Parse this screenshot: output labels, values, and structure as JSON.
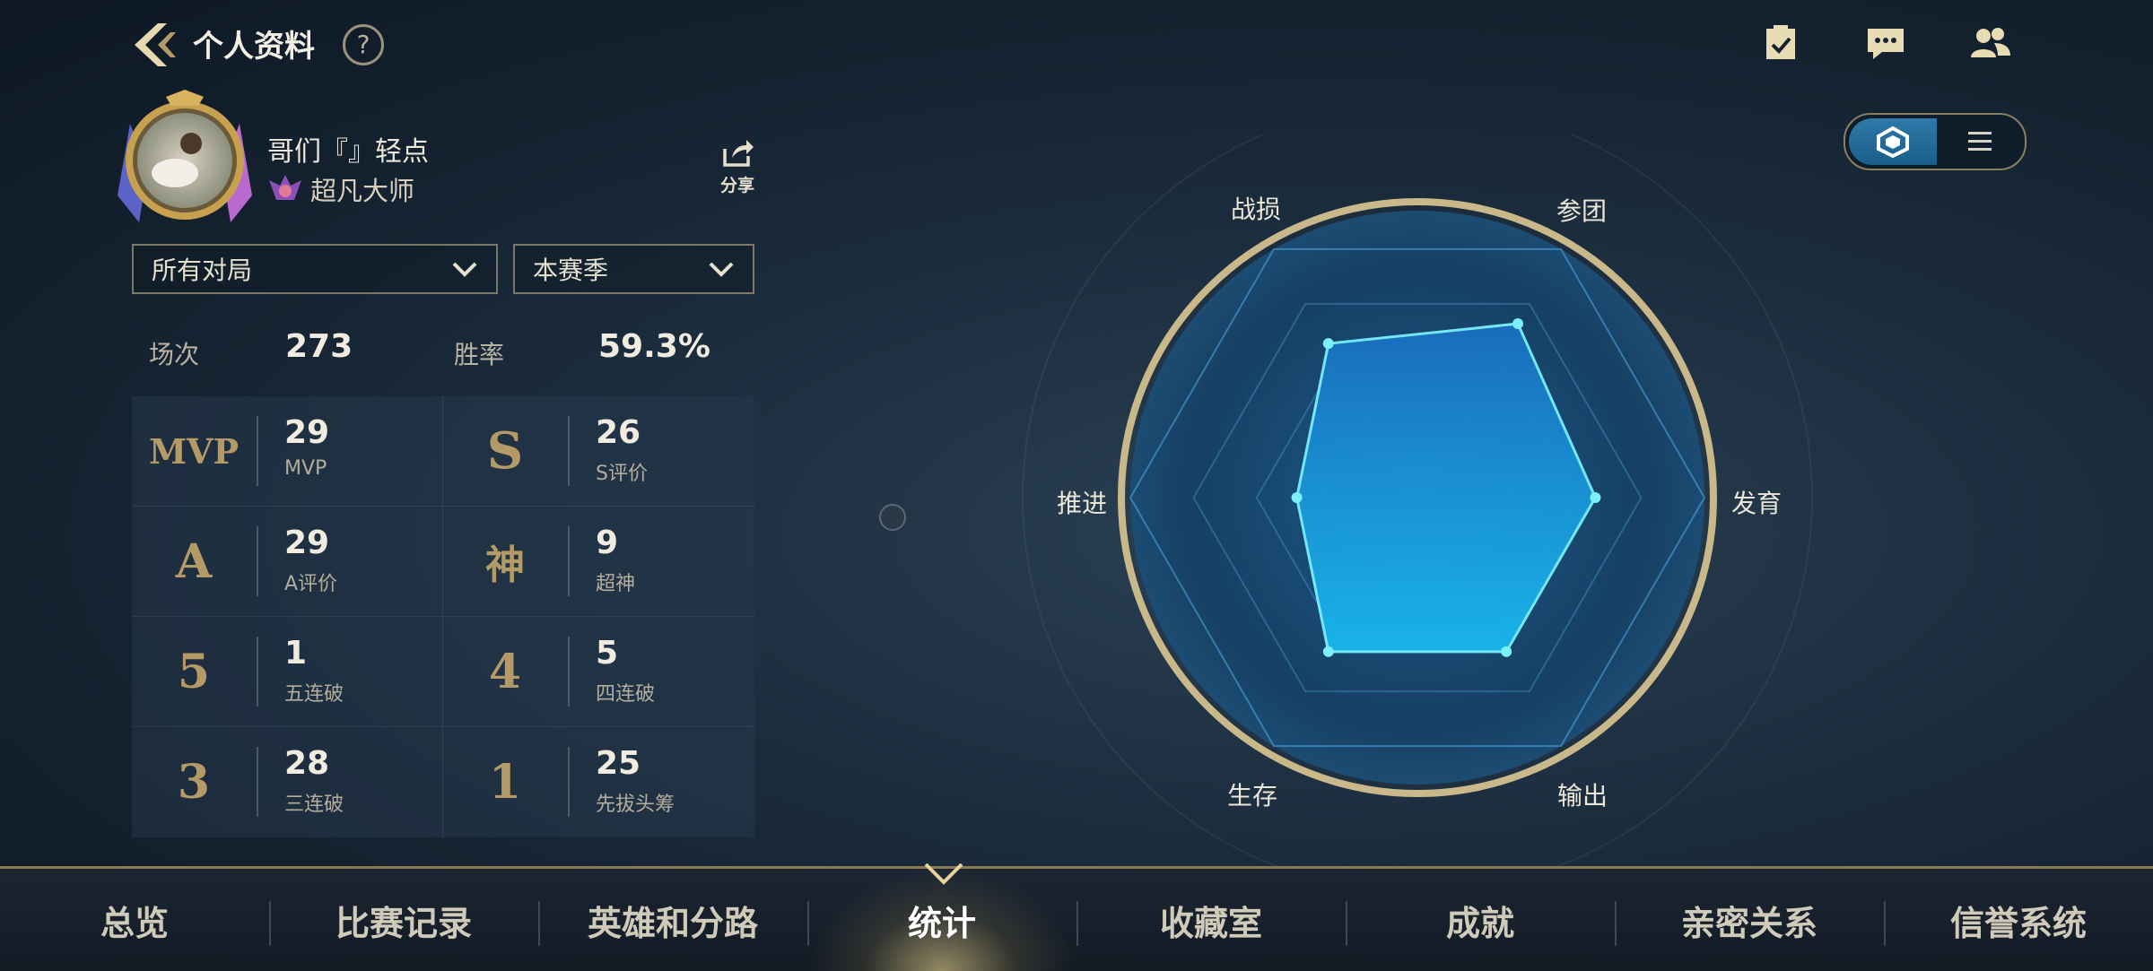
{
  "header": {
    "title": "个人资料",
    "help_symbol": "?",
    "icons": [
      "task-check-icon",
      "chat-icon",
      "friends-icon"
    ]
  },
  "profile": {
    "name": "哥们『』轻点",
    "rank": "超凡大师",
    "share_label": "分享"
  },
  "filters": {
    "mode": "所有对局",
    "season": "本赛季"
  },
  "summary": {
    "games_label": "场次",
    "games_value": "273",
    "winrate_label": "胜率",
    "winrate_value": "59.3%"
  },
  "stats": [
    {
      "icon_text": "MVP",
      "value": "29",
      "label": "MVP"
    },
    {
      "icon_text": "S",
      "value": "26",
      "label": "S评价"
    },
    {
      "icon_text": "A",
      "value": "29",
      "label": "A评价"
    },
    {
      "icon_text": "神",
      "value": "9",
      "label": "超神"
    },
    {
      "icon_text": "5",
      "value": "1",
      "label": "五连破"
    },
    {
      "icon_text": "4",
      "value": "5",
      "label": "四连破"
    },
    {
      "icon_text": "3",
      "value": "28",
      "label": "三连破"
    },
    {
      "icon_text": "1",
      "value": "25",
      "label": "先拔头筹"
    }
  ],
  "radar": {
    "axes": [
      "战损",
      "参团",
      "发育",
      "输出",
      "生存",
      "推进"
    ],
    "values": [
      0.62,
      0.7,
      0.62,
      0.62,
      0.62,
      0.42
    ]
  },
  "view_toggle": {
    "active": "radar",
    "icons": [
      "hexagon-icon",
      "list-icon"
    ]
  },
  "nav": {
    "tabs": [
      "总览",
      "比赛记录",
      "英雄和分路",
      "统计",
      "收藏室",
      "成就",
      "亲密关系",
      "信誉系统"
    ],
    "active_index": 3
  },
  "colors": {
    "accent_gold": "#b49a66",
    "radar_fill": "#1aa6e6",
    "radar_dot": "#7af0ff"
  }
}
